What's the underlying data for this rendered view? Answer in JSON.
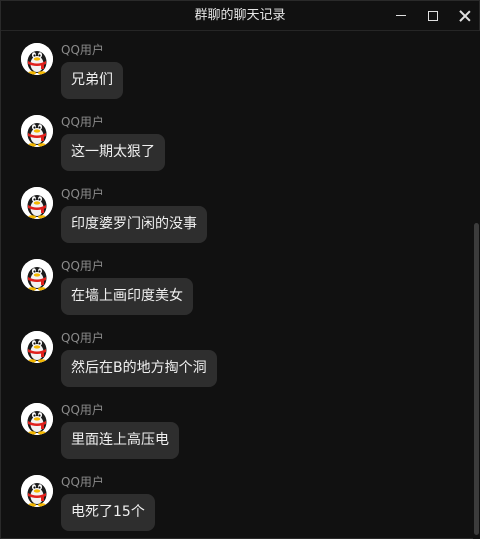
{
  "window": {
    "title": "群聊的聊天记录"
  },
  "controls": {
    "minimize_icon": "minimize-icon",
    "maximize_icon": "maximize-icon",
    "close_icon": "close-icon"
  },
  "messages": [
    {
      "sender": "QQ用户",
      "text": "兄弟们",
      "avatar": "qq-penguin-icon"
    },
    {
      "sender": "QQ用户",
      "text": "这一期太狠了",
      "avatar": "qq-penguin-icon"
    },
    {
      "sender": "QQ用户",
      "text": "印度婆罗门闲的没事",
      "avatar": "qq-penguin-icon"
    },
    {
      "sender": "QQ用户",
      "text": "在墙上画印度美女",
      "avatar": "qq-penguin-icon"
    },
    {
      "sender": "QQ用户",
      "text": "然后在B的地方掏个洞",
      "avatar": "qq-penguin-icon"
    },
    {
      "sender": "QQ用户",
      "text": "里面连上高压电",
      "avatar": "qq-penguin-icon"
    },
    {
      "sender": "QQ用户",
      "text": "电死了15个",
      "avatar": "qq-penguin-icon"
    }
  ],
  "colors": {
    "background": "#111111",
    "bubble": "#2e2e2e",
    "sender": "#8a8a8a",
    "text": "#f0f0f0"
  }
}
